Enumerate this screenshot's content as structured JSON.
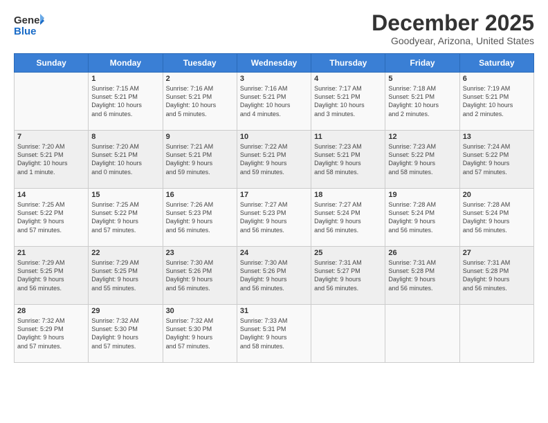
{
  "header": {
    "logo_general": "General",
    "logo_blue": "Blue",
    "month_title": "December 2025",
    "location": "Goodyear, Arizona, United States"
  },
  "days_of_week": [
    "Sunday",
    "Monday",
    "Tuesday",
    "Wednesday",
    "Thursday",
    "Friday",
    "Saturday"
  ],
  "weeks": [
    [
      {
        "day": "",
        "content": ""
      },
      {
        "day": "1",
        "content": "Sunrise: 7:15 AM\nSunset: 5:21 PM\nDaylight: 10 hours\nand 6 minutes."
      },
      {
        "day": "2",
        "content": "Sunrise: 7:16 AM\nSunset: 5:21 PM\nDaylight: 10 hours\nand 5 minutes."
      },
      {
        "day": "3",
        "content": "Sunrise: 7:16 AM\nSunset: 5:21 PM\nDaylight: 10 hours\nand 4 minutes."
      },
      {
        "day": "4",
        "content": "Sunrise: 7:17 AM\nSunset: 5:21 PM\nDaylight: 10 hours\nand 3 minutes."
      },
      {
        "day": "5",
        "content": "Sunrise: 7:18 AM\nSunset: 5:21 PM\nDaylight: 10 hours\nand 2 minutes."
      },
      {
        "day": "6",
        "content": "Sunrise: 7:19 AM\nSunset: 5:21 PM\nDaylight: 10 hours\nand 2 minutes."
      }
    ],
    [
      {
        "day": "7",
        "content": "Sunrise: 7:20 AM\nSunset: 5:21 PM\nDaylight: 10 hours\nand 1 minute."
      },
      {
        "day": "8",
        "content": "Sunrise: 7:20 AM\nSunset: 5:21 PM\nDaylight: 10 hours\nand 0 minutes."
      },
      {
        "day": "9",
        "content": "Sunrise: 7:21 AM\nSunset: 5:21 PM\nDaylight: 9 hours\nand 59 minutes."
      },
      {
        "day": "10",
        "content": "Sunrise: 7:22 AM\nSunset: 5:21 PM\nDaylight: 9 hours\nand 59 minutes."
      },
      {
        "day": "11",
        "content": "Sunrise: 7:23 AM\nSunset: 5:21 PM\nDaylight: 9 hours\nand 58 minutes."
      },
      {
        "day": "12",
        "content": "Sunrise: 7:23 AM\nSunset: 5:22 PM\nDaylight: 9 hours\nand 58 minutes."
      },
      {
        "day": "13",
        "content": "Sunrise: 7:24 AM\nSunset: 5:22 PM\nDaylight: 9 hours\nand 57 minutes."
      }
    ],
    [
      {
        "day": "14",
        "content": "Sunrise: 7:25 AM\nSunset: 5:22 PM\nDaylight: 9 hours\nand 57 minutes."
      },
      {
        "day": "15",
        "content": "Sunrise: 7:25 AM\nSunset: 5:22 PM\nDaylight: 9 hours\nand 57 minutes."
      },
      {
        "day": "16",
        "content": "Sunrise: 7:26 AM\nSunset: 5:23 PM\nDaylight: 9 hours\nand 56 minutes."
      },
      {
        "day": "17",
        "content": "Sunrise: 7:27 AM\nSunset: 5:23 PM\nDaylight: 9 hours\nand 56 minutes."
      },
      {
        "day": "18",
        "content": "Sunrise: 7:27 AM\nSunset: 5:24 PM\nDaylight: 9 hours\nand 56 minutes."
      },
      {
        "day": "19",
        "content": "Sunrise: 7:28 AM\nSunset: 5:24 PM\nDaylight: 9 hours\nand 56 minutes."
      },
      {
        "day": "20",
        "content": "Sunrise: 7:28 AM\nSunset: 5:24 PM\nDaylight: 9 hours\nand 56 minutes."
      }
    ],
    [
      {
        "day": "21",
        "content": "Sunrise: 7:29 AM\nSunset: 5:25 PM\nDaylight: 9 hours\nand 56 minutes."
      },
      {
        "day": "22",
        "content": "Sunrise: 7:29 AM\nSunset: 5:25 PM\nDaylight: 9 hours\nand 55 minutes."
      },
      {
        "day": "23",
        "content": "Sunrise: 7:30 AM\nSunset: 5:26 PM\nDaylight: 9 hours\nand 56 minutes."
      },
      {
        "day": "24",
        "content": "Sunrise: 7:30 AM\nSunset: 5:26 PM\nDaylight: 9 hours\nand 56 minutes."
      },
      {
        "day": "25",
        "content": "Sunrise: 7:31 AM\nSunset: 5:27 PM\nDaylight: 9 hours\nand 56 minutes."
      },
      {
        "day": "26",
        "content": "Sunrise: 7:31 AM\nSunset: 5:28 PM\nDaylight: 9 hours\nand 56 minutes."
      },
      {
        "day": "27",
        "content": "Sunrise: 7:31 AM\nSunset: 5:28 PM\nDaylight: 9 hours\nand 56 minutes."
      }
    ],
    [
      {
        "day": "28",
        "content": "Sunrise: 7:32 AM\nSunset: 5:29 PM\nDaylight: 9 hours\nand 57 minutes."
      },
      {
        "day": "29",
        "content": "Sunrise: 7:32 AM\nSunset: 5:30 PM\nDaylight: 9 hours\nand 57 minutes."
      },
      {
        "day": "30",
        "content": "Sunrise: 7:32 AM\nSunset: 5:30 PM\nDaylight: 9 hours\nand 57 minutes."
      },
      {
        "day": "31",
        "content": "Sunrise: 7:33 AM\nSunset: 5:31 PM\nDaylight: 9 hours\nand 58 minutes."
      },
      {
        "day": "",
        "content": ""
      },
      {
        "day": "",
        "content": ""
      },
      {
        "day": "",
        "content": ""
      }
    ]
  ]
}
